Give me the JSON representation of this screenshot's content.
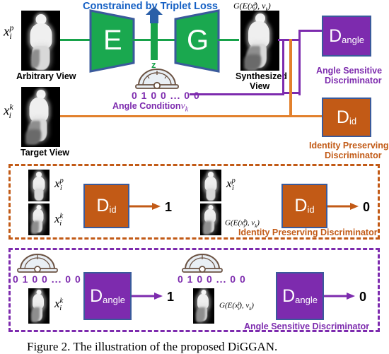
{
  "figure": {
    "caption": "Figure 2. The illustration of the proposed DiGGAN.",
    "colors": {
      "green": "#17a24a",
      "blue": "#1560c4",
      "purple": "#7d2bae",
      "orange": "#c25a16",
      "orange_line": "#e2802c",
      "border_navy": "#3a5a9b"
    }
  },
  "top": {
    "triplet_loss_label": "Constrained by Triplet Loss",
    "input_p_symbol": "x",
    "input_p_sup": "p",
    "input_p_sub": "i",
    "arbitrary_view_label": "Arbitrary View",
    "input_k_symbol": "x",
    "input_k_sup": "k",
    "input_k_sub": "i",
    "target_view_label": "Target View",
    "encoder_letter": "E",
    "generator_letter": "G",
    "latent_label": "z",
    "synth_formula": "G(E(x",
    "synth_formula_sup": "p",
    "synth_formula_sub": "i",
    "synth_formula_tail": "), v",
    "synth_formula_tail_sub": "k",
    "synth_formula_close": ")",
    "synthesized_view_label_line1": "Synthesized",
    "synthesized_view_label_line2": "View",
    "angle_bits": "0 1 0 0 ... 0 0",
    "angle_condition_label": "Angle Condition",
    "angle_condition_symbol": "v",
    "angle_condition_sub": "k",
    "d_angle_letter": "D",
    "d_angle_sub": "angle",
    "d_angle_caption_line1": "Angle Sensitive",
    "d_angle_caption_line2": "Discriminator",
    "d_id_letter": "D",
    "d_id_sub": "id",
    "d_id_caption_line1": "Identity Preserving",
    "d_id_caption_line2": "Discriminator",
    "protractor_icon": "protractor-icon"
  },
  "panel_id": {
    "title": "Identity Preserving Discriminator",
    "left": {
      "input_top_symbol": "x",
      "input_top_sup": "p",
      "input_top_sub": "i",
      "input_bottom_symbol": "x",
      "input_bottom_sup": "k",
      "input_bottom_sub": "i",
      "block_letter": "D",
      "block_sub": "id",
      "output": "1"
    },
    "right": {
      "input_top_symbol": "x",
      "input_top_sup": "p",
      "input_top_sub": "i",
      "input_bottom_formula": "G(E(x",
      "input_bottom_sup": "p",
      "input_bottom_sub": "i",
      "input_bottom_tail": "), v",
      "input_bottom_tail_sub": "k",
      "input_bottom_close": ")",
      "block_letter": "D",
      "block_sub": "id",
      "output": "0"
    }
  },
  "panel_angle": {
    "title": "Angle Sensitive Discriminator",
    "left": {
      "angle_bits": "0 1 0 0 ... 0 0",
      "image_symbol": "x",
      "image_sup": "k",
      "image_sub": "i",
      "block_letter": "D",
      "block_sub": "angle",
      "output": "1"
    },
    "right": {
      "angle_bits": "0 1 0 0 ... 0 0",
      "image_formula": "G(E(x",
      "image_sup": "p",
      "image_sub": "i",
      "image_tail": "), v",
      "image_tail_sub": "k",
      "image_close": ")",
      "block_letter": "D",
      "block_sub": "angle",
      "output": "0"
    }
  }
}
